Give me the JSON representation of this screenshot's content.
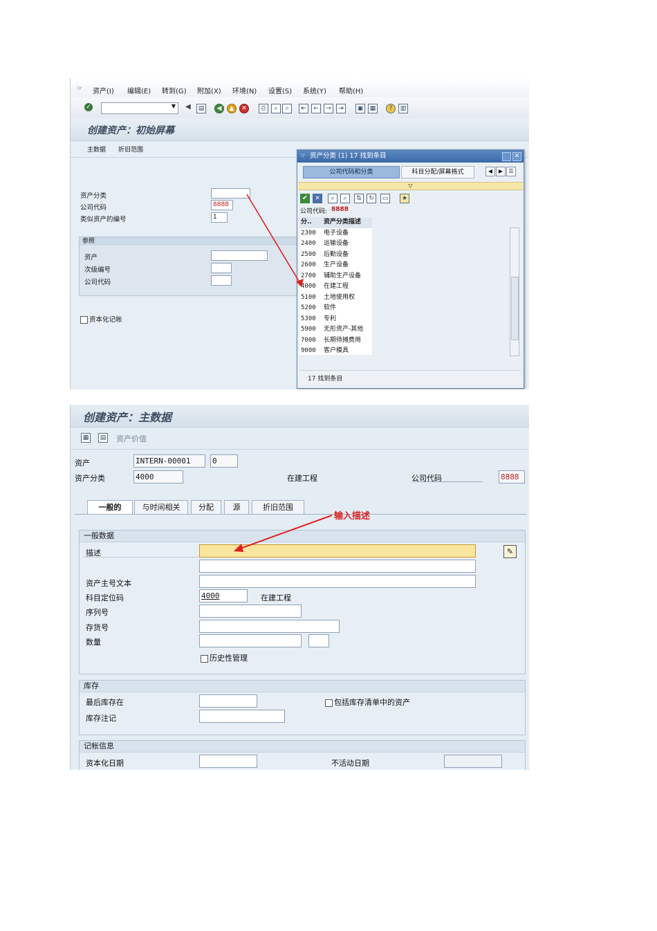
{
  "screen1": {
    "menu": [
      "资产(I)",
      "编辑(E)",
      "转到(G)",
      "附加(X)",
      "环境(N)",
      "设置(S)",
      "系统(Y)",
      "帮助(H)"
    ],
    "title": "创建资产：初始屏幕",
    "subbuttons": [
      "主数据",
      "折旧范围"
    ],
    "fields": {
      "asset_class_label": "资产分类",
      "company_code_label": "公司代码",
      "company_code_value": "8888",
      "similar_assets_label": "类似资产的编号",
      "similar_assets_value": "1"
    },
    "reference": {
      "header": "参照",
      "asset_label": "资产",
      "sub_number_label": "次级编号",
      "company_code_label": "公司代码"
    },
    "capitalize_label": "资本化记帐"
  },
  "popup": {
    "title": "资产分类 (1)   17 找到条目",
    "tab_active": "公司代码和分类",
    "tab_other": "科目分配/屏幕格式",
    "company_code_label": "公司代码:",
    "company_code_value": "8888",
    "col_code": "分..",
    "col_desc": "资产分类描述",
    "rows": [
      {
        "code": "2300",
        "desc": "电子设备"
      },
      {
        "code": "2400",
        "desc": "运输设备"
      },
      {
        "code": "2500",
        "desc": "后勤设备"
      },
      {
        "code": "2600",
        "desc": "生产设备"
      },
      {
        "code": "2700",
        "desc": "辅助生产设备"
      },
      {
        "code": "4000",
        "desc": "在建工程"
      },
      {
        "code": "5100",
        "desc": "土地使用权"
      },
      {
        "code": "5200",
        "desc": "软件"
      },
      {
        "code": "5300",
        "desc": "专利"
      },
      {
        "code": "5900",
        "desc": "无形资产-其他"
      },
      {
        "code": "7000",
        "desc": "长期待摊费用"
      },
      {
        "code": "9000",
        "desc": "客户模具"
      }
    ],
    "status": "17 找到条目"
  },
  "screen2": {
    "title": "创建资产：主数据",
    "values_button": "资产价值",
    "asset_label": "资产",
    "asset_value": "INTERN-00001",
    "asset_sub": "0",
    "class_label": "资产分类",
    "class_value": "4000",
    "class_desc": "在建工程",
    "company_label": "公司代码",
    "company_value": "8888",
    "tabs": [
      "一般的",
      "与时间相关",
      "分配",
      "源",
      "折旧范围"
    ],
    "annotation": "输入描述",
    "general": {
      "header": "一般数据",
      "desc_label": "描述",
      "main_text_label": "资产主号文本",
      "acct_det_label": "科目定位码",
      "acct_det_value": "4000",
      "acct_det_desc": "在建工程",
      "serial_label": "序列号",
      "inventory_no_label": "存货号",
      "qty_label": "数量",
      "history_label": "历史性管理"
    },
    "inventory": {
      "header": "库存",
      "last_label": "最后库存在",
      "include_label": "包括库存清单中的资产",
      "note_label": "库存注记"
    },
    "posting": {
      "header": "记帐信息",
      "cap_date_label": "资本化日期",
      "deact_label": "不活动日期"
    }
  }
}
